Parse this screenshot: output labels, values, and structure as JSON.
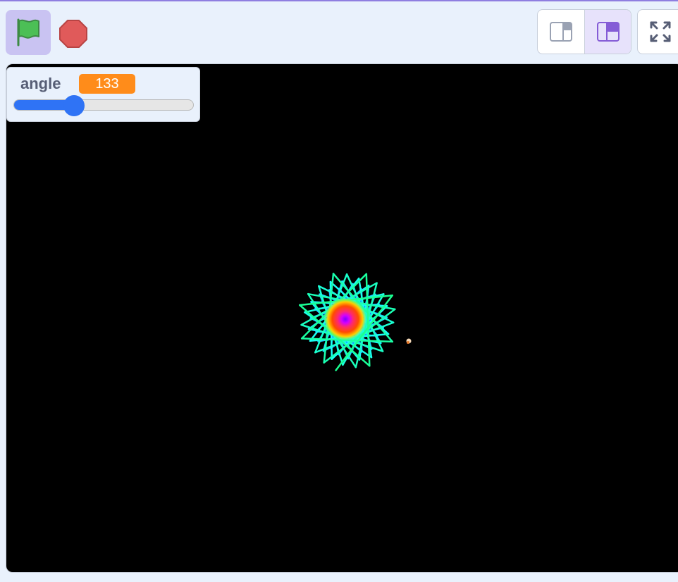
{
  "toolbar": {
    "green_flag_icon": "green-flag-icon",
    "stop_icon": "stop-sign-icon",
    "small_stage_icon": "small-stage-layout-icon",
    "normal_stage_icon": "normal-stage-layout-icon",
    "fullscreen_icon": "fullscreen-icon"
  },
  "monitor": {
    "label": "angle",
    "value": "133",
    "slider_fraction": 0.337
  },
  "colors": {
    "accent_purple": "#855cd6",
    "flag_green": "#4cbf56",
    "stop_red": "#e05a5a",
    "variable_orange": "#ff8c1a",
    "slider_blue": "#2f73f5",
    "stage_bg": "#000000"
  }
}
